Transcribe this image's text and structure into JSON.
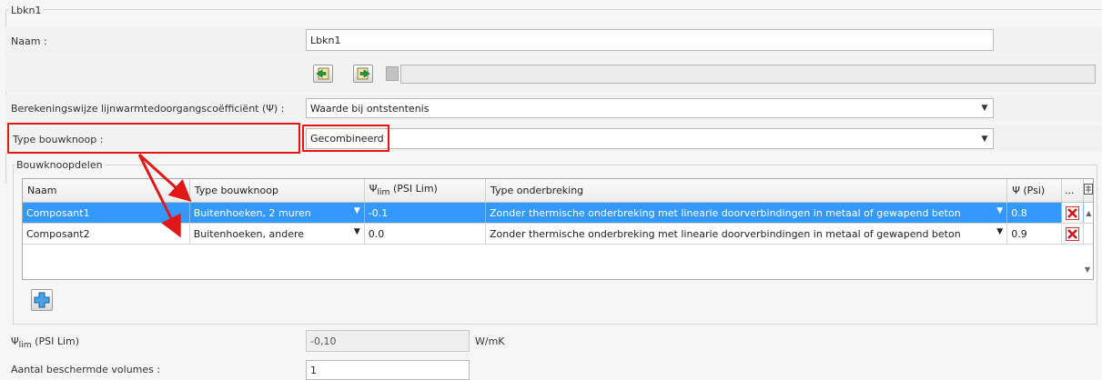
{
  "header": {
    "title": "Lbkn1"
  },
  "name_row": {
    "label": "Naam :",
    "value": "Lbkn1"
  },
  "calc_row": {
    "label": "Berekeningswijze lijnwarmtedoorgangscoëfficiënt (Ψ) :",
    "value": "Waarde bij ontstentenis"
  },
  "type_row": {
    "label": "Type bouwknoop :",
    "value": "Gecombineerd"
  },
  "section": {
    "title": "Bouwknoopdelen"
  },
  "table": {
    "headers": {
      "naam": "Naam",
      "type": "Type bouwknoop",
      "psi_lim_prefix": "Ψ",
      "psi_lim_sub": "lim",
      "psi_lim_suffix": " (PSI Lim)",
      "onderbreking": "Type onderbreking",
      "psi": "Ψ (Psi)",
      "more": "..."
    },
    "rows": [
      {
        "naam": "Composant1",
        "type": "Buitenhoeken, 2 muren",
        "psi_lim": "-0.1",
        "onderbreking": "Zonder thermische onderbreking met linearie doorverbindingen in metaal of gewapend beton",
        "psi": "0.8"
      },
      {
        "naam": "Composant2",
        "type": "Buitenhoeken, andere",
        "psi_lim": "0.0",
        "onderbreking": "Zonder thermische onderbreking met linearie doorverbindingen in metaal of gewapend beton",
        "psi": "0.9"
      }
    ]
  },
  "psi_lim_row": {
    "label_prefix": "Ψ",
    "label_sub": "lim",
    "label_suffix": " (PSI Lim)",
    "value": "-0,10",
    "unit": "W/mK"
  },
  "volumes_row": {
    "label": "Aantal beschermde volumes :",
    "value": "1"
  },
  "colors": {
    "selection": "#3399ff",
    "highlight": "#e01818",
    "background": "#f6f6f6"
  }
}
